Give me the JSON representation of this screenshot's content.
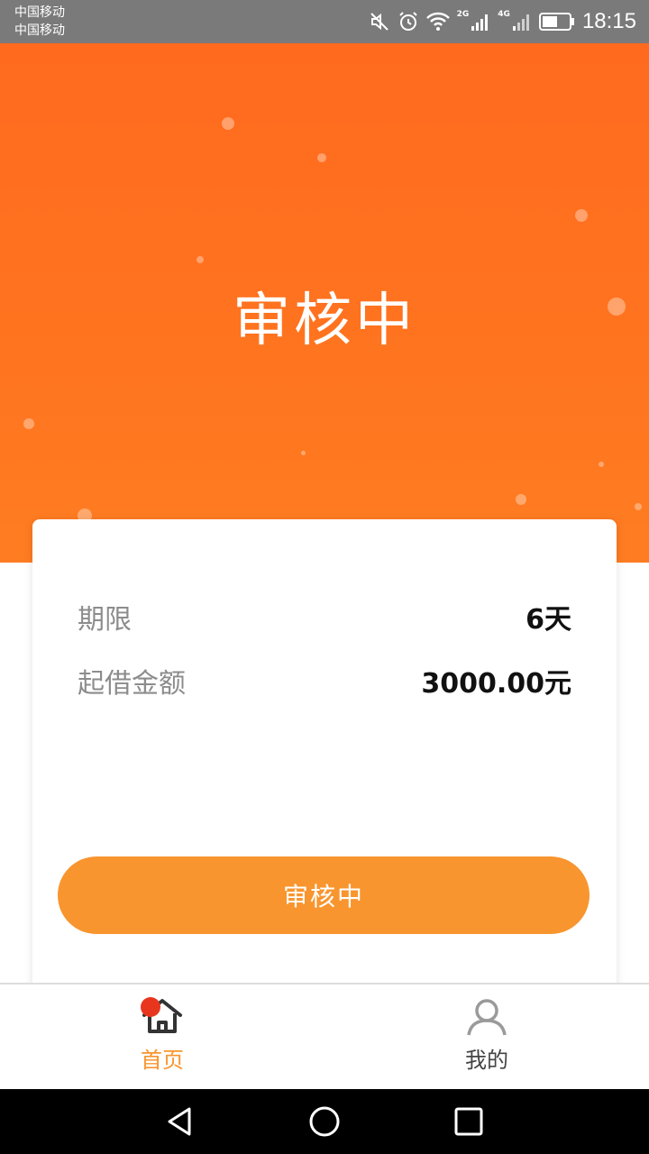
{
  "status_bar": {
    "carrier_1": "中国移动",
    "carrier_2": "中国移动",
    "sig1_label": "2G",
    "sig2_label": "4G",
    "time": "18:15",
    "icons": [
      "mute-icon",
      "alarm-icon",
      "wifi-icon",
      "signal-2g-icon",
      "signal-4g-icon",
      "battery-icon"
    ]
  },
  "hero": {
    "title": "审核中",
    "background": "#ff6a1f"
  },
  "loan": {
    "rows": [
      {
        "label": "期限",
        "value": "6天"
      },
      {
        "label": "起借金额",
        "value": "3000.00元"
      }
    ],
    "status_button": "审核中",
    "button_color": "#f8952e"
  },
  "tabbar": {
    "tabs": [
      {
        "label": "首页",
        "icon": "home-icon",
        "active": true
      },
      {
        "label": "我的",
        "icon": "user-icon",
        "active": false
      }
    ],
    "active_color": "#f8952e"
  },
  "system_nav": {
    "icons": [
      "back-icon",
      "home-circle-icon",
      "recents-icon"
    ]
  }
}
